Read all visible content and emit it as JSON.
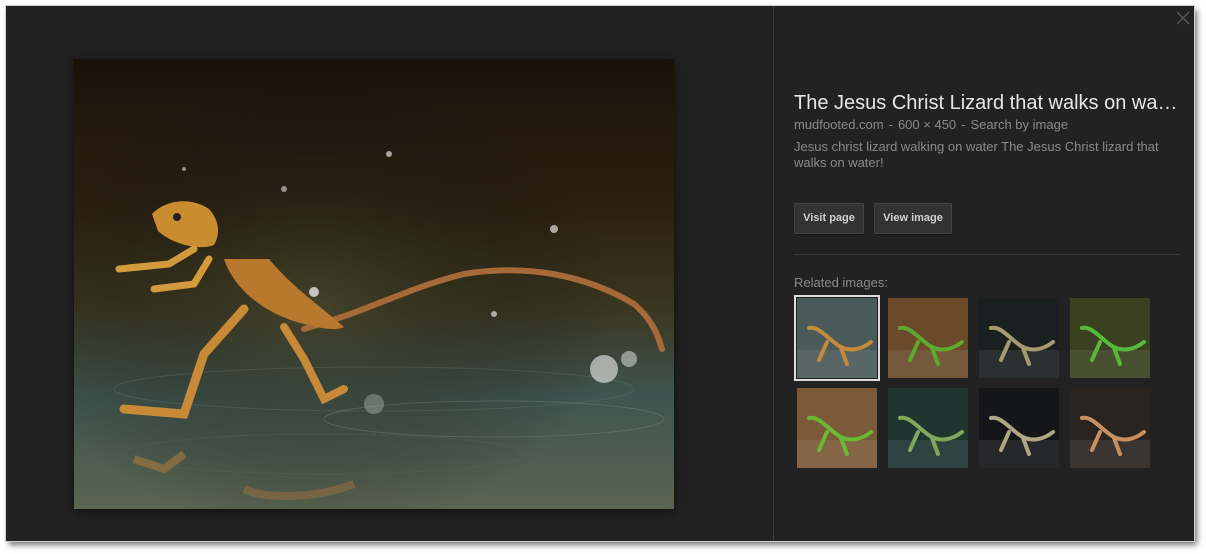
{
  "viewer": {
    "title": "The Jesus Christ Lizard that walks on water",
    "source": "mudfooted.com",
    "dimensions": "600 × 450",
    "search_by_image": "Search by image",
    "description": "Jesus christ lizard walking on water The Jesus Christ lizard that walks on water!",
    "visit_page_label": "Visit page",
    "view_image_label": "View image",
    "related_label": "Related images:",
    "close_icon": "close-icon"
  },
  "related_images": [
    {
      "name": "related-thumb-1",
      "bg": "#4a5a5a",
      "subject": "#c58a3a",
      "selected": true
    },
    {
      "name": "related-thumb-2",
      "bg": "#6b4a2a",
      "subject": "#5ea830",
      "selected": false
    },
    {
      "name": "related-thumb-3",
      "bg": "#1a1f20",
      "subject": "#a89a70",
      "selected": false
    },
    {
      "name": "related-thumb-4",
      "bg": "#3a4020",
      "subject": "#58b83a",
      "selected": false
    },
    {
      "name": "related-thumb-5",
      "bg": "#7a5a38",
      "subject": "#6ab833",
      "selected": false
    },
    {
      "name": "related-thumb-6",
      "bg": "#1e3530",
      "subject": "#7fa85a",
      "selected": false
    },
    {
      "name": "related-thumb-7",
      "bg": "#141617",
      "subject": "#b0a585",
      "selected": false
    },
    {
      "name": "related-thumb-8",
      "bg": "#2a2420",
      "subject": "#c89060",
      "selected": false
    }
  ]
}
